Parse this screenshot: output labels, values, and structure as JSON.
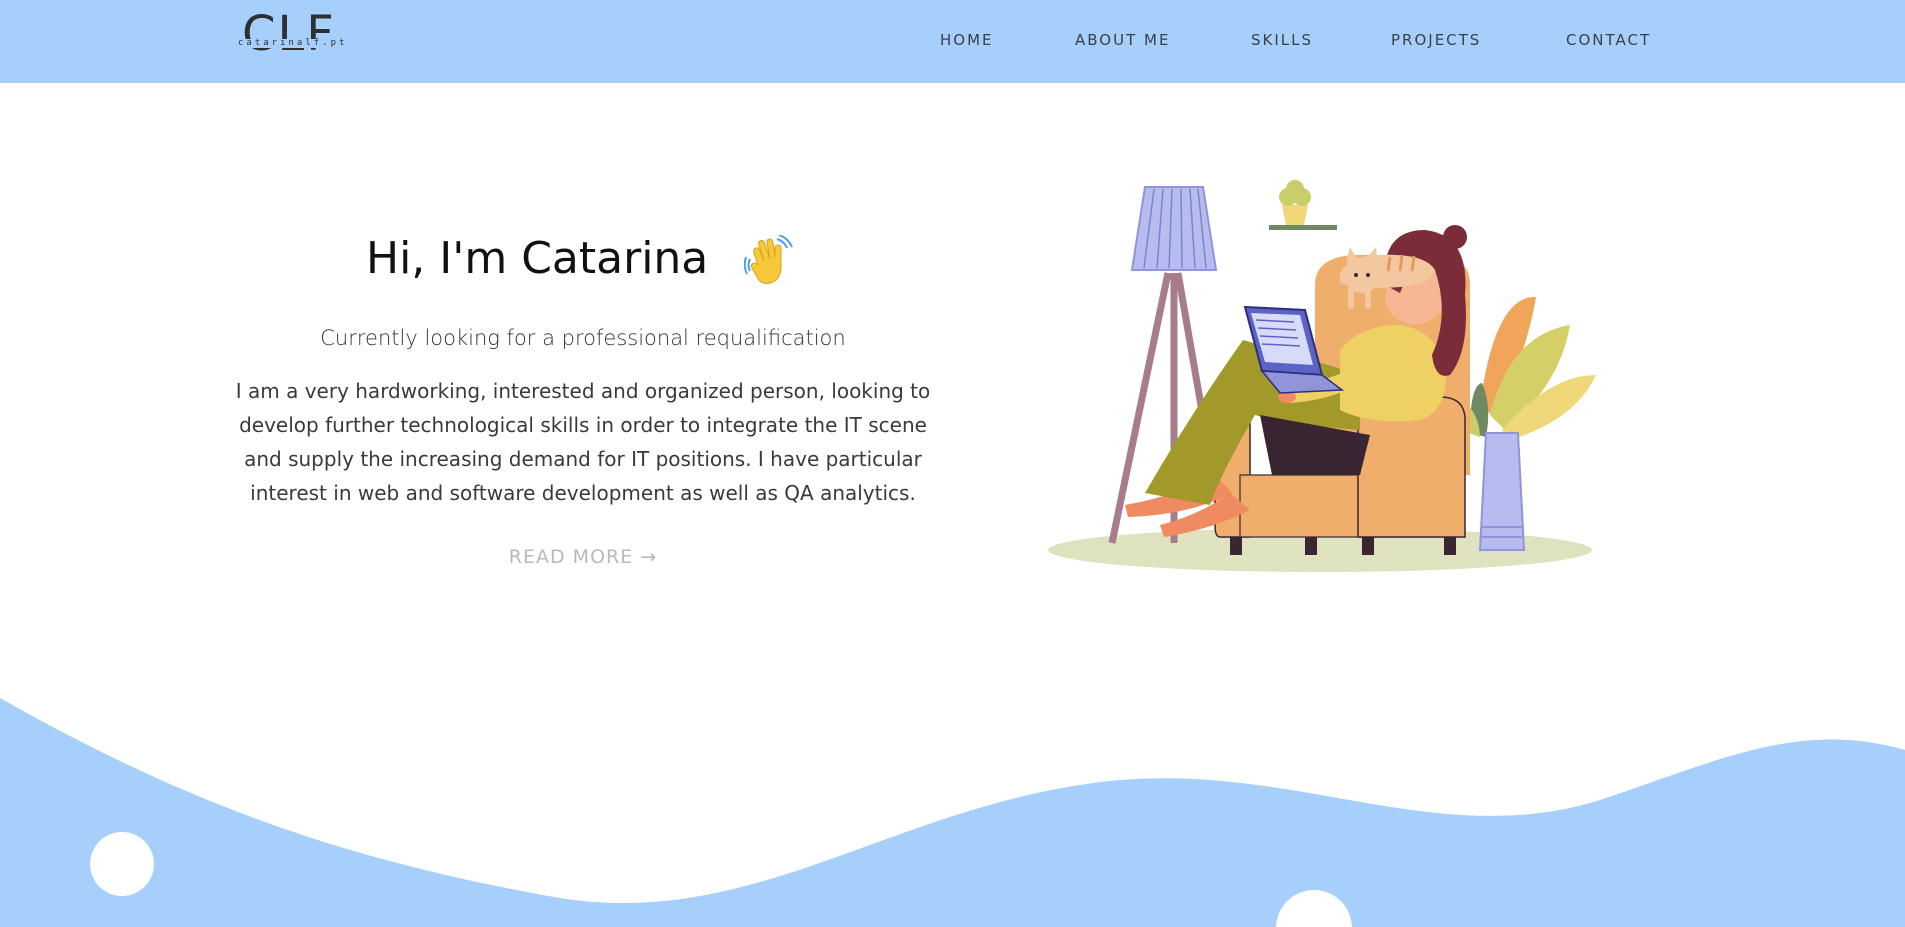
{
  "header": {
    "logo_text": "CLF",
    "logo_subtext": "catarinalf.pt",
    "nav": [
      {
        "label": "HOME"
      },
      {
        "label": "ABOUT ME"
      },
      {
        "label": "SKILLS"
      },
      {
        "label": "PROJECTS"
      },
      {
        "label": "CONTACT"
      }
    ]
  },
  "hero": {
    "title": "Hi, I'm Catarina",
    "subtitle": "Currently looking for a professional requalification",
    "bio": "I am a very hardworking, interested and organized person, looking to develop further technological skills in order to integrate the IT scene and supply the increasing demand for IT positions. I have particular interest in web and software development as well as QA analytics.",
    "read_more": "READ MORE →"
  },
  "colors": {
    "header_bg": "#a6cffb",
    "wave_bg": "#a6cffb",
    "text": "#111111",
    "nav_text": "#3a3f48",
    "muted": "#b7b9bc"
  },
  "icons": {
    "greeting": "waving-hand-icon",
    "illustration": "woman-on-armchair-with-laptop-and-cat"
  }
}
